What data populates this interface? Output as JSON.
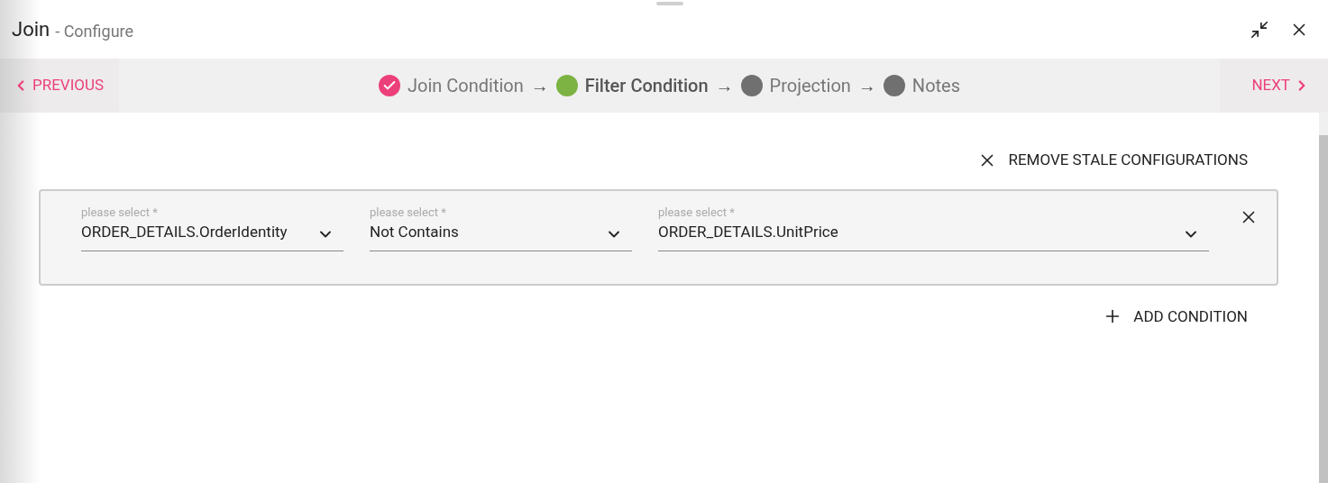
{
  "window": {
    "title": "Join",
    "subtitle": "- Configure"
  },
  "nav": {
    "previous": "PREVIOUS",
    "next": "NEXT"
  },
  "steps": [
    {
      "label": "Join Condition",
      "done": true,
      "selected": false
    },
    {
      "label": "Filter Condition",
      "done": false,
      "selected": true,
      "arrow": "→"
    },
    {
      "label": "Projection",
      "done": false,
      "selected": false,
      "arrow": "→"
    },
    {
      "label": "Notes",
      "done": false,
      "selected": false,
      "arrow": "→"
    }
  ],
  "remove_action": "REMOVE STALE CONFIGURATIONS",
  "conditions": [
    {
      "fields": [
        {
          "label": "please select *",
          "value": "ORDER_DETAILS.OrderIdentity"
        },
        {
          "label": "please select *",
          "value": "Not Contains"
        },
        {
          "label": "please select *",
          "value": "ORDER_DETAILS.UnitPrice"
        }
      ]
    }
  ],
  "add_action": "ADD CONDITION"
}
